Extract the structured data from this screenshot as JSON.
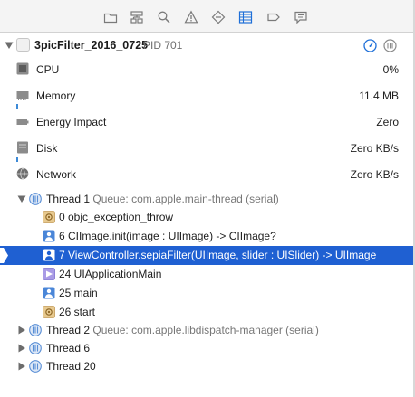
{
  "toolbar": {
    "icons": [
      "folder-icon",
      "hierarchy-icon",
      "search-icon",
      "warning-icon",
      "diamond-icon",
      "debug-gauges-icon",
      "breakpoint-icon",
      "log-icon"
    ],
    "active_icon": "debug-gauges-icon",
    "accent_color": "#1e6fd8"
  },
  "process": {
    "name": "3picFilter_2016_0725",
    "pid": "PID 701"
  },
  "gauges": [
    {
      "label": "CPU",
      "value": "0%",
      "icon": "cpu-icon"
    },
    {
      "label": "Memory",
      "value": "11.4 MB",
      "icon": "memory-icon"
    },
    {
      "label": "Energy Impact",
      "value": "Zero",
      "icon": "battery-icon"
    },
    {
      "label": "Disk",
      "value": "Zero KB/s",
      "icon": "disk-icon"
    },
    {
      "label": "Network",
      "value": "Zero KB/s",
      "icon": "network-icon"
    }
  ],
  "threads": [
    {
      "label": "Thread 1",
      "queue": "Queue: com.apple.main-thread (serial)",
      "expanded": true,
      "frames": [
        {
          "label": "0 objc_exception_throw",
          "icon": "system-frame-icon"
        },
        {
          "label": "6 CIImage.init(image : UIImage) -> CIImage?",
          "icon": "user-frame-icon"
        },
        {
          "label": "7 ViewController.sepiaFilter(UIImage, slider : UISlider) -> UIImage",
          "icon": "user-frame-icon",
          "selected": true
        },
        {
          "label": "24 UIApplicationMain",
          "icon": "uikit-frame-icon"
        },
        {
          "label": "25 main",
          "icon": "user-frame-icon"
        },
        {
          "label": "26 start",
          "icon": "system-frame-icon"
        }
      ]
    },
    {
      "label": "Thread 2",
      "queue": "Queue: com.apple.libdispatch-manager (serial)",
      "expanded": false
    },
    {
      "label": "Thread 6",
      "queue": "",
      "expanded": false
    },
    {
      "label": "Thread 20",
      "queue": "",
      "expanded": false
    }
  ],
  "colors": {
    "selection": "#1f60d2",
    "thread_icon": "#5a8fd6",
    "system_frame": "#c9a46a",
    "user_frame": "#4a86d8",
    "uikit_frame": "#8e7fd6"
  }
}
